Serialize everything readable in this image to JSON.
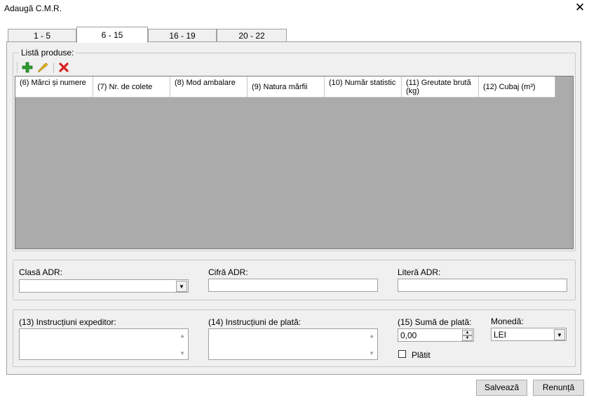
{
  "window": {
    "title": "Adaugă C.M.R."
  },
  "tabs": [
    {
      "label": "1 - 5"
    },
    {
      "label": "6 - 15"
    },
    {
      "label": "16 - 19"
    },
    {
      "label": "20 - 22"
    }
  ],
  "active_tab": "6 - 15",
  "products": {
    "legend": "Listă produse:",
    "columns": [
      "(6) Mărci și numere",
      "(7) Nr. de colete",
      "(8) Mod ambalare",
      "(9) Natura mărfii",
      "(10) Număr statistic",
      "(11) Greutate brută (kg)",
      "(12) Cubaj (m³)"
    ],
    "rows": []
  },
  "adr": {
    "class_label": "Clasă ADR:",
    "class_value": "",
    "cifra_label": "Cifră ADR:",
    "cifra_value": "",
    "litera_label": "Literă ADR:",
    "litera_value": ""
  },
  "payment": {
    "sender_instr_label": "(13) Instrucțiuni expeditor:",
    "payment_instr_label": "(14) Instrucțiuni de plată:",
    "amount_label": "(15) Sumă de plată:",
    "amount_value": "0,00",
    "currency_label": "Monedă:",
    "currency_value": "LEI",
    "paid_label": "Plătit",
    "paid_checked": false
  },
  "buttons": {
    "save": "Salvează",
    "cancel": "Renunță"
  },
  "colors": {
    "grid_bg": "#ababab",
    "panel_bg": "#f0f0f0",
    "add_icon": "#2e9e2e",
    "delete_icon": "#d92020",
    "edit_icon": "#e8b820"
  }
}
